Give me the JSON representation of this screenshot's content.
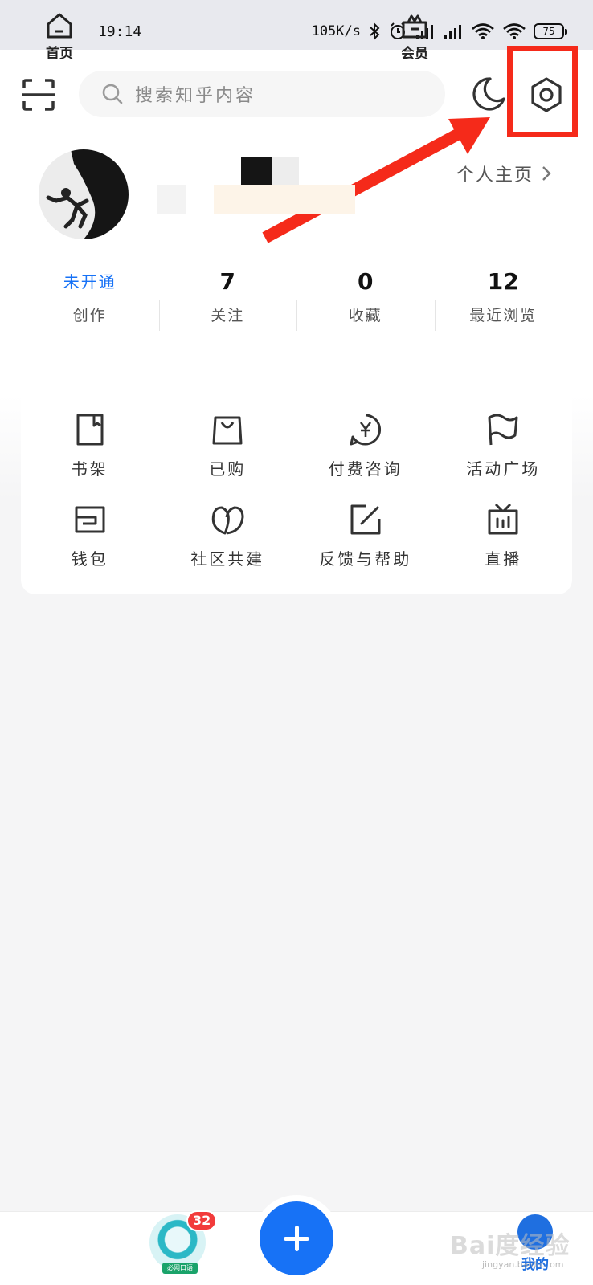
{
  "status_bar": {
    "time": "19:14",
    "network_speed": "105K/s",
    "battery": "75"
  },
  "header": {
    "search_placeholder": "搜索知乎内容",
    "icons": [
      "scan-icon",
      "search-icon",
      "night-mode-icon",
      "settings-icon"
    ]
  },
  "profile": {
    "homepage_link": "个人主页"
  },
  "stats": [
    {
      "value": "未开通",
      "label": "创作"
    },
    {
      "value": "7",
      "label": "关注"
    },
    {
      "value": "0",
      "label": "收藏"
    },
    {
      "value": "12",
      "label": "最近浏览"
    }
  ],
  "functions": [
    {
      "label": "书架",
      "icon": "bookshelf-icon"
    },
    {
      "label": "已购",
      "icon": "shopping-bag-icon"
    },
    {
      "label": "付费咨询",
      "icon": "paid-consult-icon"
    },
    {
      "label": "活动广场",
      "icon": "flag-icon"
    },
    {
      "label": "钱包",
      "icon": "wallet-icon"
    },
    {
      "label": "社区共建",
      "icon": "community-icon"
    },
    {
      "label": "反馈与帮助",
      "icon": "feedback-icon"
    },
    {
      "label": "直播",
      "icon": "tv-icon"
    }
  ],
  "bottom_nav": {
    "home": "首页",
    "badge_count": "32",
    "circle_caption": "必网口语",
    "vip": "会员",
    "me": "我的"
  },
  "watermark": {
    "brand": "Bai度经验",
    "url": "jingyan.baidu.com"
  },
  "colors": {
    "accent_blue": "#1772f6",
    "annotation_red": "#f52a1a",
    "badge_red": "#f23b3b"
  }
}
